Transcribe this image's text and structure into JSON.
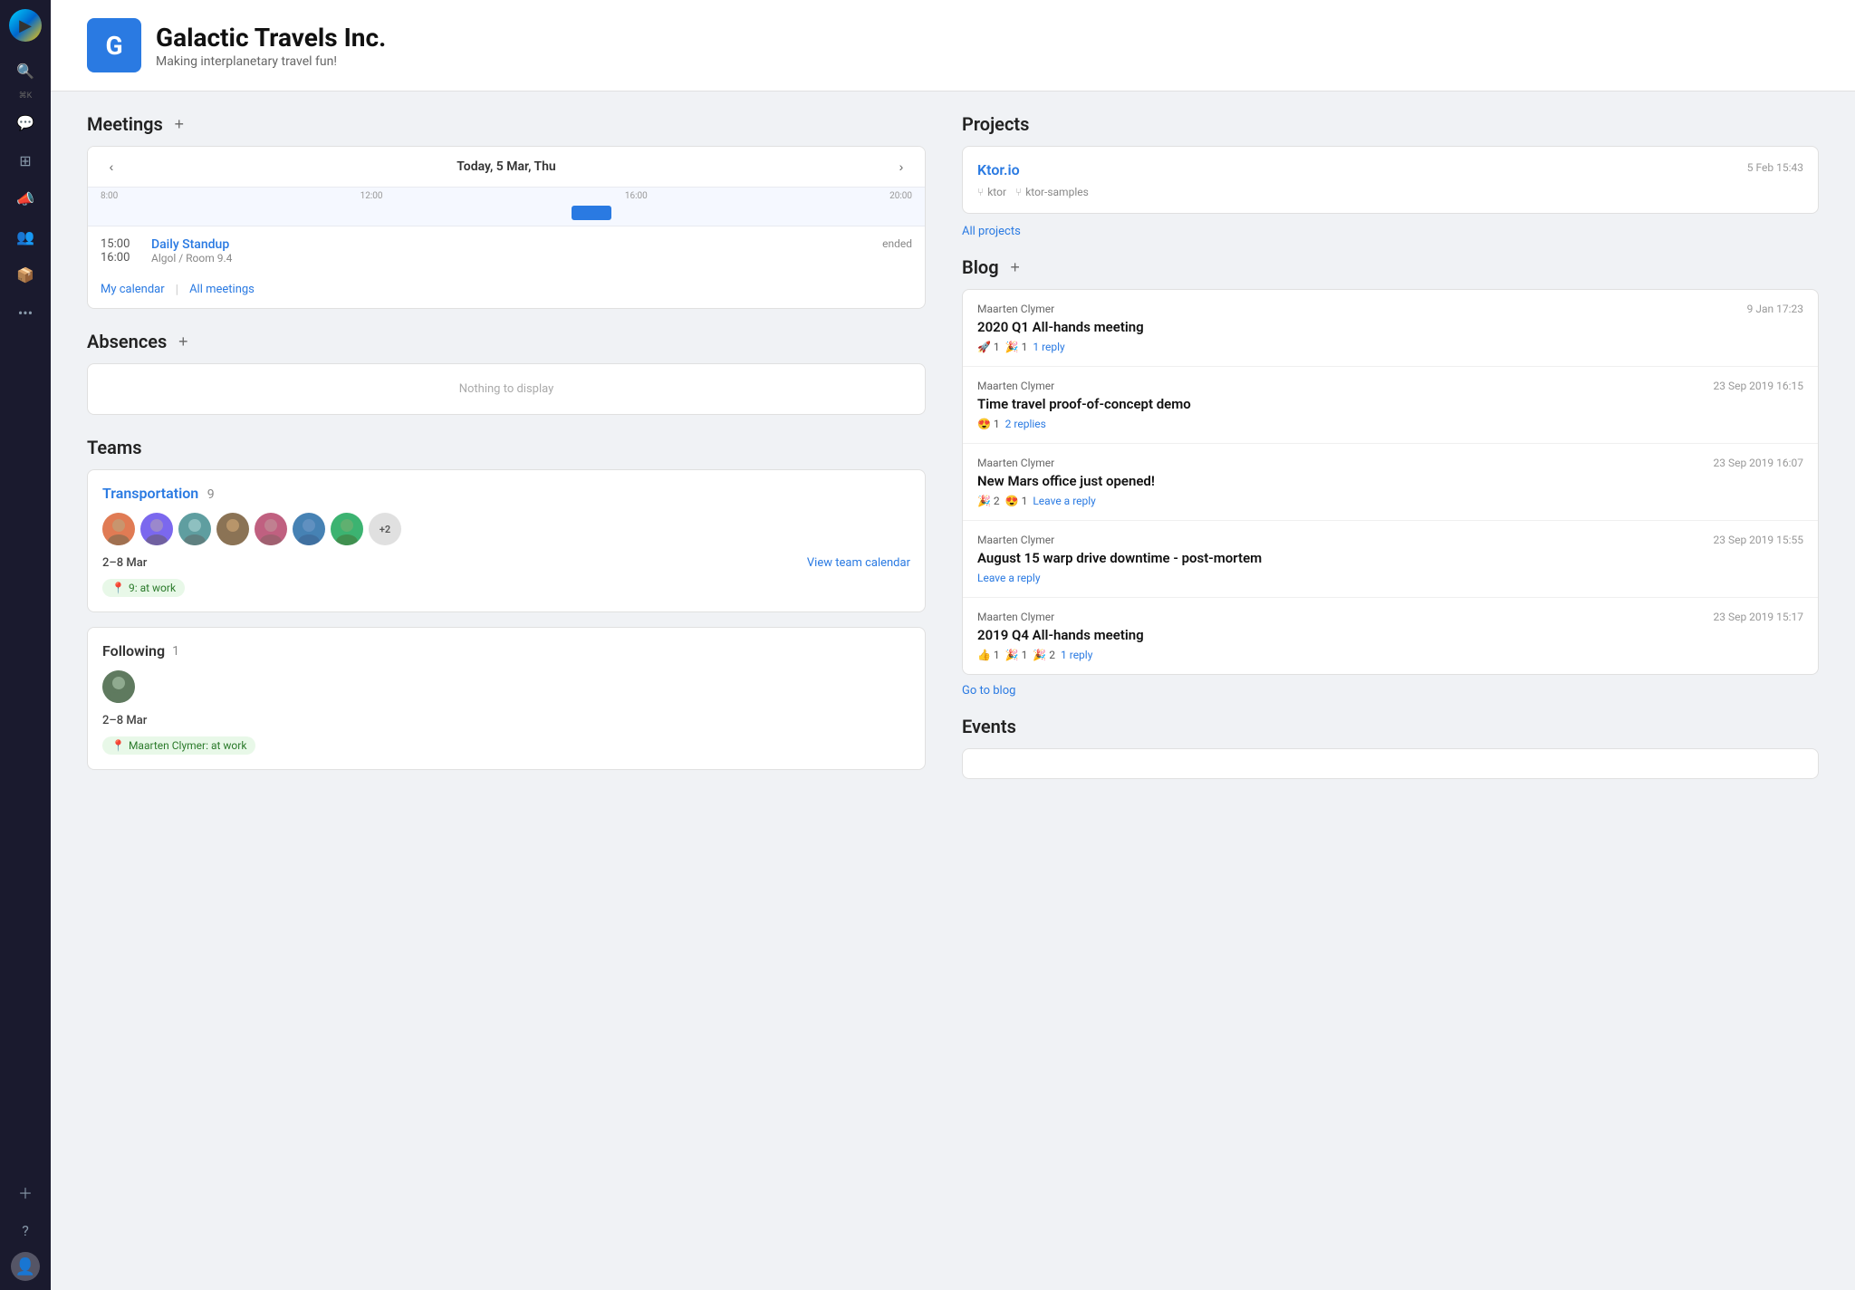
{
  "app": {
    "logo_icon": "▶",
    "brand_name": "Galactic Travels Inc.",
    "brand_tagline": "Making interplanetary travel fun!",
    "header_logo_letter": "G"
  },
  "sidebar": {
    "icons": [
      "search",
      "messages",
      "grid",
      "megaphone",
      "users",
      "cube",
      "more"
    ],
    "search_shortcut": "⌘K",
    "bottom_icons": [
      "plus",
      "question",
      "user-avatar"
    ]
  },
  "meetings": {
    "section_title": "Meetings",
    "calendar_title": "Today, 5 Mar, Thu",
    "timeline_labels": [
      "8:00",
      "12:00",
      "16:00",
      "20:00"
    ],
    "event_time_start": "15:00",
    "event_name": "Daily Standup",
    "event_status": "ended",
    "event_time_detail": "16:00",
    "event_room": "Algol / Room 9.4",
    "my_calendar": "My calendar",
    "all_meetings": "All meetings"
  },
  "absences": {
    "section_title": "Absences",
    "empty_message": "Nothing to display"
  },
  "teams": {
    "section_title": "Teams",
    "team_name": "Transportation",
    "team_count": "9",
    "member_count": "+2",
    "date_range": "2–8 Mar",
    "view_calendar": "View team calendar",
    "status": "9: at work"
  },
  "following": {
    "section_title": "Following",
    "count": "1",
    "date_range": "2–8 Mar",
    "status": "Maarten Clymer: at work"
  },
  "projects": {
    "section_title": "Projects",
    "project_name": "Ktor.io",
    "project_date": "5 Feb 15:43",
    "project_tag1": "ktor",
    "project_tag2": "ktor-samples",
    "all_projects": "All projects"
  },
  "blog": {
    "section_title": "Blog",
    "go_to_blog": "Go to blog",
    "posts": [
      {
        "author": "Maarten Clymer",
        "date": "9 Jan 17:23",
        "title": "2020 Q1 All-hands meeting",
        "reactions": [
          {
            "emoji": "🚀",
            "count": "1"
          },
          {
            "emoji": "🎉",
            "count": "1"
          }
        ],
        "reply_text": "1 reply"
      },
      {
        "author": "Maarten Clymer",
        "date": "23 Sep 2019 16:15",
        "title": "Time travel proof-of-concept demo",
        "reactions": [
          {
            "emoji": "😍",
            "count": "1"
          }
        ],
        "reply_text": "2 replies"
      },
      {
        "author": "Maarten Clymer",
        "date": "23 Sep 2019 16:07",
        "title": "New Mars office just opened!",
        "reactions": [
          {
            "emoji": "🎉",
            "count": "2"
          },
          {
            "emoji": "😍",
            "count": "1"
          }
        ],
        "reply_text": "Leave a reply"
      },
      {
        "author": "Maarten Clymer",
        "date": "23 Sep 2019 15:55",
        "title": "August 15 warp drive downtime - post-mortem",
        "reactions": [],
        "reply_text": "Leave a reply"
      },
      {
        "author": "Maarten Clymer",
        "date": "23 Sep 2019 15:17",
        "title": "2019 Q4 All-hands meeting",
        "reactions": [
          {
            "emoji": "👍",
            "count": "1"
          },
          {
            "emoji": "🎉",
            "count": "1"
          },
          {
            "emoji": "🎉",
            "count": "2"
          }
        ],
        "reply_text": "1 reply"
      }
    ]
  },
  "events": {
    "section_title": "Events"
  }
}
